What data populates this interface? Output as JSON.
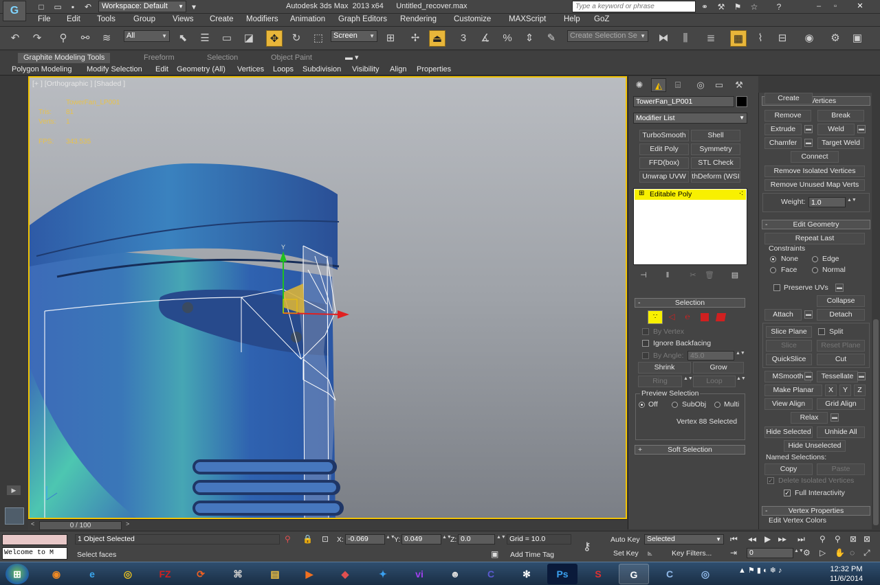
{
  "titlebar": {
    "workspace": "Workspace: Default",
    "title": "Autodesk 3ds Max  2013 x64      Untitled_recover.max",
    "search_placeholder": "Type a keyword or phrase"
  },
  "menu": [
    "File",
    "Edit",
    "Tools",
    "Group",
    "Views",
    "Create",
    "Modifiers",
    "Animation",
    "Graph Editors",
    "Rendering",
    "Customize",
    "MAXScript",
    "Help",
    "GoZ"
  ],
  "toolbar": {
    "selection_filter": "All",
    "ref_coord": "Screen",
    "named_selection_placeholder": "Create Selection Se"
  },
  "ribbon": {
    "tabs": [
      "Graphite Modeling Tools",
      "Freeform",
      "Selection",
      "Object Paint"
    ],
    "subtabs": [
      "Polygon Modeling",
      "Modify Selection",
      "Edit",
      "Geometry (All)",
      "Vertices",
      "Loops",
      "Subdivision",
      "Visibility",
      "Align",
      "Properties"
    ]
  },
  "viewport": {
    "label": "[+ ] [Orthographic ] [Shaded ]",
    "object_name": "TowerFan_LP001",
    "tris_label": "Tris:",
    "tris_value": "81",
    "verts_label": "Verts:",
    "verts_value": "1",
    "fps_label": "FPS:",
    "fps_value": "343.535",
    "gizmo_y_label": "Y"
  },
  "command_panel": {
    "object_name": "TowerFan_LP001",
    "modifier_list": "Modifier List",
    "modifier_buttons": [
      "TurboSmooth",
      "Shell",
      "Edit Poly",
      "Symmetry",
      "FFD(box)",
      "STL Check",
      "Unwrap UVW",
      "thDeform (WSI"
    ],
    "stack_item": "Editable Poly",
    "selection": {
      "title": "Selection",
      "by_vertex": "By Vertex",
      "ignore_backfacing": "Ignore Backfacing",
      "by_angle": "By Angle:",
      "angle_value": "45.0",
      "shrink": "Shrink",
      "grow": "Grow",
      "ring": "Ring",
      "loop": "Loop",
      "preview_label": "Preview Selection",
      "preview_off": "Off",
      "preview_subobj": "SubObj",
      "preview_multi": "Multi",
      "status": "Vertex 88 Selected"
    },
    "soft_selection": "Soft Selection"
  },
  "right_panel": {
    "edit_vertices": {
      "title": "Edit Vertices",
      "remove": "Remove",
      "break": "Break",
      "extrude": "Extrude",
      "weld": "Weld",
      "chamfer": "Chamfer",
      "target_weld": "Target Weld",
      "connect": "Connect",
      "remove_isolated": "Remove Isolated Vertices",
      "remove_unused_map": "Remove Unused Map Verts",
      "weight_label": "Weight:",
      "weight_value": "1.0"
    },
    "edit_geometry": {
      "title": "Edit Geometry",
      "repeat_last": "Repeat Last",
      "constraints": "Constraints",
      "none": "None",
      "edge": "Edge",
      "face": "Face",
      "normal": "Normal",
      "preserve_uvs": "Preserve UVs",
      "create": "Create",
      "collapse": "Collapse",
      "attach": "Attach",
      "detach": "Detach",
      "slice_plane": "Slice Plane",
      "split": "Split",
      "slice": "Slice",
      "reset_plane": "Reset Plane",
      "quickslice": "QuickSlice",
      "cut": "Cut",
      "msmooth": "MSmooth",
      "tessellate": "Tessellate",
      "make_planar": "Make Planar",
      "x": "X",
      "y": "Y",
      "z": "Z",
      "view_align": "View Align",
      "grid_align": "Grid Align",
      "relax": "Relax",
      "hide_selected": "Hide Selected",
      "unhide_all": "Unhide All",
      "hide_unselected": "Hide Unselected",
      "named_selections": "Named Selections:",
      "copy": "Copy",
      "paste": "Paste",
      "delete_isolated": "Delete Isolated Vertices",
      "full_interactivity": "Full Interactivity"
    },
    "vertex_properties": "Vertex Properties",
    "edit_vertex_colors": "Edit Vertex Colors"
  },
  "timeline": {
    "frame": "0 / 100"
  },
  "status": {
    "maxscript_output": "Welcome to M",
    "objects_selected": "1 Object Selected",
    "prompt": "Select faces",
    "x_label": "X:",
    "x_value": "-0.069",
    "y_label": "Y:",
    "y_value": "0.049",
    "z_label": "Z:",
    "z_value": "0.0",
    "grid": "Grid = 10.0",
    "add_time_tag": "Add Time Tag",
    "auto_key": "Auto Key",
    "set_key": "Set Key",
    "key_mode": "Selected",
    "key_filters": "Key Filters...",
    "current_frame": "0"
  },
  "taskbar": {
    "time": "12:32 PM",
    "date": "11/6/2014"
  },
  "colors": {
    "viewport_border": "#f3c400",
    "stack_highlight": "#f8f000",
    "active_tool": "#e8b63a",
    "gizmo_x": "#e02020",
    "gizmo_y": "#20c020",
    "stat_text": "#e7c24d"
  }
}
